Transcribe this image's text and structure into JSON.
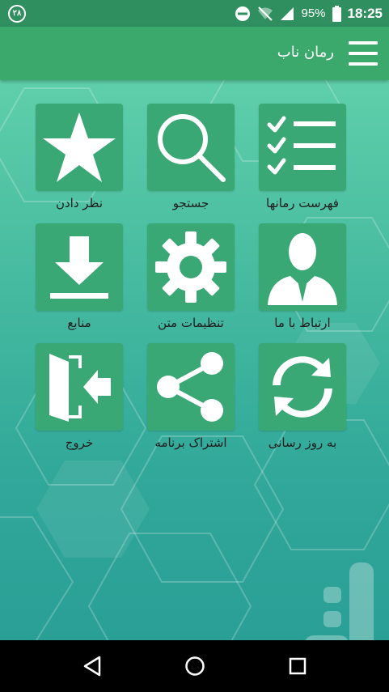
{
  "status_bar": {
    "notification_badge": "۲۸",
    "battery_percent": "95%",
    "time": "18:25"
  },
  "app_bar": {
    "title": "رمان ناب",
    "menu_icon": "hamburger-menu-icon"
  },
  "menu": [
    {
      "label": "فهرست رمانها",
      "icon": "checklist-icon"
    },
    {
      "label": "جستجو",
      "icon": "search-icon"
    },
    {
      "label": "نظر دادن",
      "icon": "star-icon"
    },
    {
      "label": "ارتباط با ما",
      "icon": "person-contact-icon"
    },
    {
      "label": "تنظیمات متن",
      "icon": "gear-icon"
    },
    {
      "label": "منابع",
      "icon": "download-icon"
    },
    {
      "label": "به روز رسانی",
      "icon": "refresh-icon"
    },
    {
      "label": "اشتراک برنامه",
      "icon": "share-icon"
    },
    {
      "label": "خروج",
      "icon": "exit-door-icon"
    }
  ],
  "colors": {
    "status_bar": "#2f8f5f",
    "app_bar": "#3ba96b",
    "tile": "#3aa874",
    "nav_bar": "#000000"
  }
}
